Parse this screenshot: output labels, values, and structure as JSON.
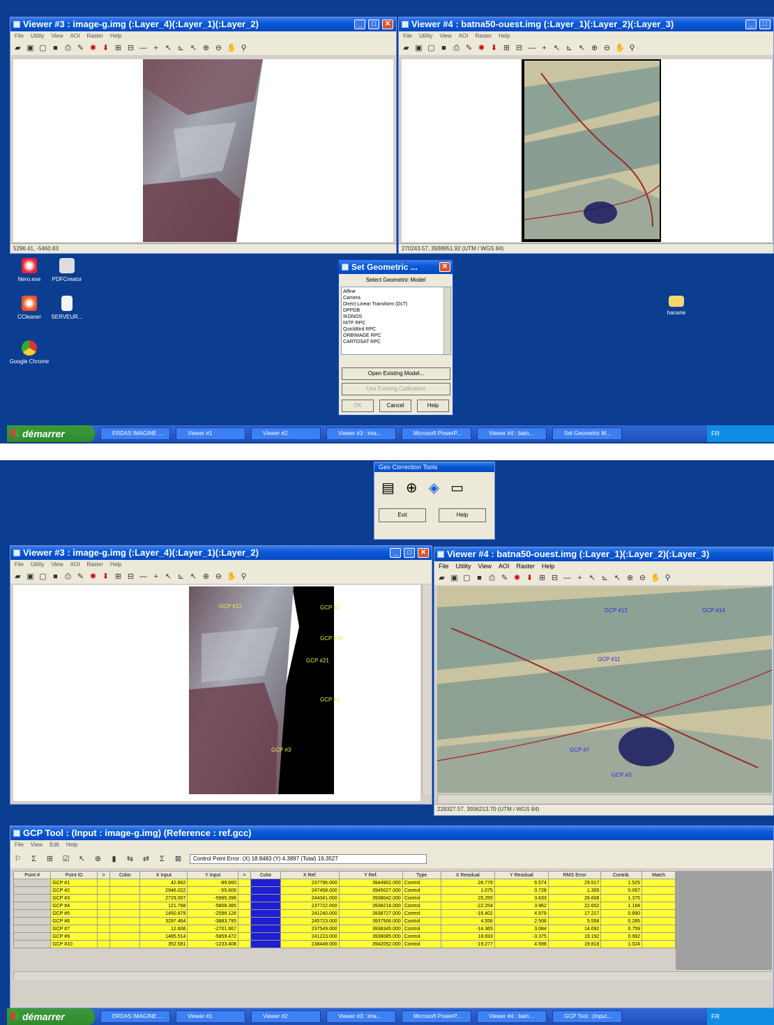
{
  "s1": {
    "v3": {
      "title": "Viewer #3 : image-g.img (:Layer_4)(:Layer_1)(:Layer_2)",
      "menu": [
        "File",
        "Utility",
        "View",
        "AOI",
        "Raster",
        "Help"
      ],
      "status": "5296.41, -5460.83"
    },
    "v4": {
      "title": "Viewer #4 : batna50-ouest.img (:Layer_1)(:Layer_2)(:Layer_3)",
      "menu": [
        "File",
        "Utility",
        "View",
        "AOI",
        "Raster",
        "Help"
      ],
      "status": "270243.57, 3938951.92  (UTM / WGS 84)"
    },
    "desktop_icons": [
      "Nero.exe",
      "PDFCreator",
      "CCleaner",
      "SERVEUR...",
      "Google Chrome",
      "hanane"
    ],
    "dialog": {
      "title": "Set Geometric ...",
      "header": "Select Geometric Model",
      "models": [
        "Affine",
        "Camera",
        "Direct Linear Transform (DLT)",
        "DPPDB",
        "IKONOS",
        "NITF RPC",
        "QuickBird RPC",
        "ORBIMAGE RPC",
        "CARTOSAT RPC"
      ],
      "open_existing": "Open Existing Model...",
      "use_existing": "Use Existing Calibration",
      "ok": "OK",
      "cancel": "Cancel",
      "help": "Help"
    },
    "taskbar": {
      "start": "démarrer",
      "tasks": [
        "ERDAS IMAGINE ...",
        "Viewer #1",
        "Viewer #2",
        "Viewer #3 : ima...",
        "Microsoft PowerP...",
        "Viewer #4 : batn...",
        "Set Geometric M..."
      ],
      "tray": "FR"
    }
  },
  "s2": {
    "gct": {
      "title": "Geo Correction Tools",
      "exit": "Exit",
      "help": "Help"
    },
    "v3": {
      "title": "Viewer #3 : image-g.img (:Layer_4)(:Layer_1)(:Layer_2)",
      "menu": [
        "File",
        "Utility",
        "View",
        "AOI",
        "Raster",
        "Help"
      ]
    },
    "v4": {
      "title": "Viewer #4 : batna50-ouest.img (:Layer_1)(:Layer_2)(:Layer_3)",
      "menu": [
        "File",
        "Utility",
        "View",
        "AOI",
        "Raster",
        "Help"
      ],
      "status": "228327.57, 3936213.70  (UTM / WGS 84)"
    },
    "left_gcps": [
      "GCP #12",
      "GCP #2",
      "GCP #20",
      "GCP #21",
      "GCP #6",
      "GCP #3"
    ],
    "right_gcps": [
      "GCP #12",
      "GCP #14",
      "GCP #11",
      "GCP #7",
      "GCP #3"
    ],
    "gcp": {
      "title": "GCP Tool : (Input : image-g.img) (Reference : ref.gcc)",
      "menu": [
        "File",
        "View",
        "Edit",
        "Help"
      ],
      "error": "Control Point Error: (X) 18.8483   (Y) 4.3897   (Total) 19.3527",
      "headers": [
        "Point #",
        "Point ID",
        ">",
        "Color",
        "X Input",
        "Y Input",
        ">",
        "Color",
        "X Ref.",
        "Y Ref.",
        "Type",
        "X Residual",
        "Y Residual",
        "RMS Error",
        "Contrib.",
        "Match"
      ],
      "rows": [
        [
          "GCP #1",
          "42.862",
          "-89.660",
          "237796.000",
          "3944902.000",
          "Control",
          "28.776",
          "6.574",
          "29.517",
          "1.525"
        ],
        [
          "GCP #2",
          "2946.022",
          "-55.606",
          "247458.000",
          "3945027.000",
          "Control",
          "1.075",
          "0.728",
          "1.300",
          "0.067"
        ],
        [
          "GCP #3",
          "2729.007",
          "-5995.396",
          "244341.000",
          "3938042.000",
          "Control",
          "25.255",
          "3.633",
          "26.608",
          "1.375"
        ],
        [
          "GCP #4",
          "121.768",
          "-5808.385",
          "237722.000",
          "3938218.000",
          "Control",
          "-22.254",
          "3.962",
          "22.602",
          "1.168"
        ],
        [
          "GCP #5",
          "1450.879",
          "-2596.126",
          "241240.000",
          "3938727.000",
          "Control",
          "-16.402",
          "4.979",
          "17.217",
          "0.890"
        ],
        [
          "GCP #6",
          "3297.464",
          "-3883.795",
          "245723.000",
          "3937506.000",
          "Control",
          "4.556",
          "2.506",
          "5.556",
          "0.285"
        ],
        [
          "GCP #7",
          "12.606",
          "-2701.667",
          "237549.000",
          "3938345.000",
          "Control",
          "-14.365",
          "3.084",
          "14.692",
          "0.759"
        ],
        [
          "GCP #9",
          "1485.514",
          "-5859.472",
          "241223.000",
          "3938085.000",
          "Control",
          "18.693",
          "-3.375",
          "19.192",
          "0.992"
        ],
        [
          "GCP #10",
          "352.581",
          "-1233.408",
          "238449.000",
          "3942052.000",
          "Control",
          "-19.277",
          "4.598",
          "19.818",
          "1.024"
        ]
      ]
    },
    "taskbar": {
      "start": "démarrer",
      "tasks": [
        "ERDAS IMAGINE ...",
        "Viewer #1",
        "Viewer #2",
        "Viewer #3 : ima...",
        "Microsoft PowerP...",
        "Viewer #4 : batn...",
        "GCP Tool : (Input..."
      ],
      "tray": "FR"
    }
  }
}
